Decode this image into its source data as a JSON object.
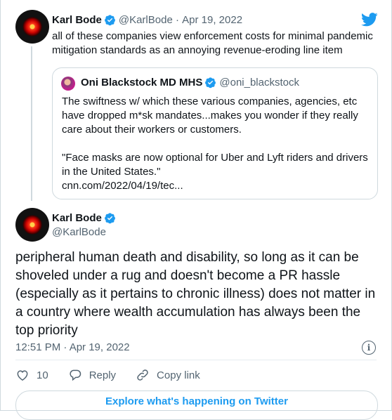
{
  "parent_tweet": {
    "author_name": "Karl Bode",
    "handle": "@KarlBode",
    "date": "Apr 19, 2022",
    "text": "all of these companies view enforcement costs for minimal pandemic mitigation standards as an annoying revenue-eroding line item"
  },
  "quoted_tweet": {
    "author_name": "Oni Blackstock MD MHS",
    "handle": "@oni_blackstock",
    "line1": "The swiftness w/ which these various companies, agencies, etc have dropped m*sk mandates...makes you wonder if they really care about their workers or customers.",
    "line2": "\"Face masks are now optional for Uber and Lyft riders and drivers in the United States.\"",
    "link": "cnn.com/2022/04/19/tec..."
  },
  "main_tweet": {
    "author_name": "Karl Bode",
    "handle": "@KarlBode",
    "text": "peripheral human death and disability, so long as it can be shoveled under a rug and doesn't become a PR hassle (especially as it pertains to chronic illness) does not matter in a country where wealth accumulation has always been the top priority",
    "timestamp": "12:51 PM · Apr 19, 2022"
  },
  "actions": {
    "like_count": "10",
    "reply_label": "Reply",
    "copy_link_label": "Copy link"
  },
  "explore_label": "Explore what's happening on Twitter",
  "colors": {
    "accent": "#1d9bf0",
    "muted": "#536471",
    "border": "#cfd9de"
  }
}
